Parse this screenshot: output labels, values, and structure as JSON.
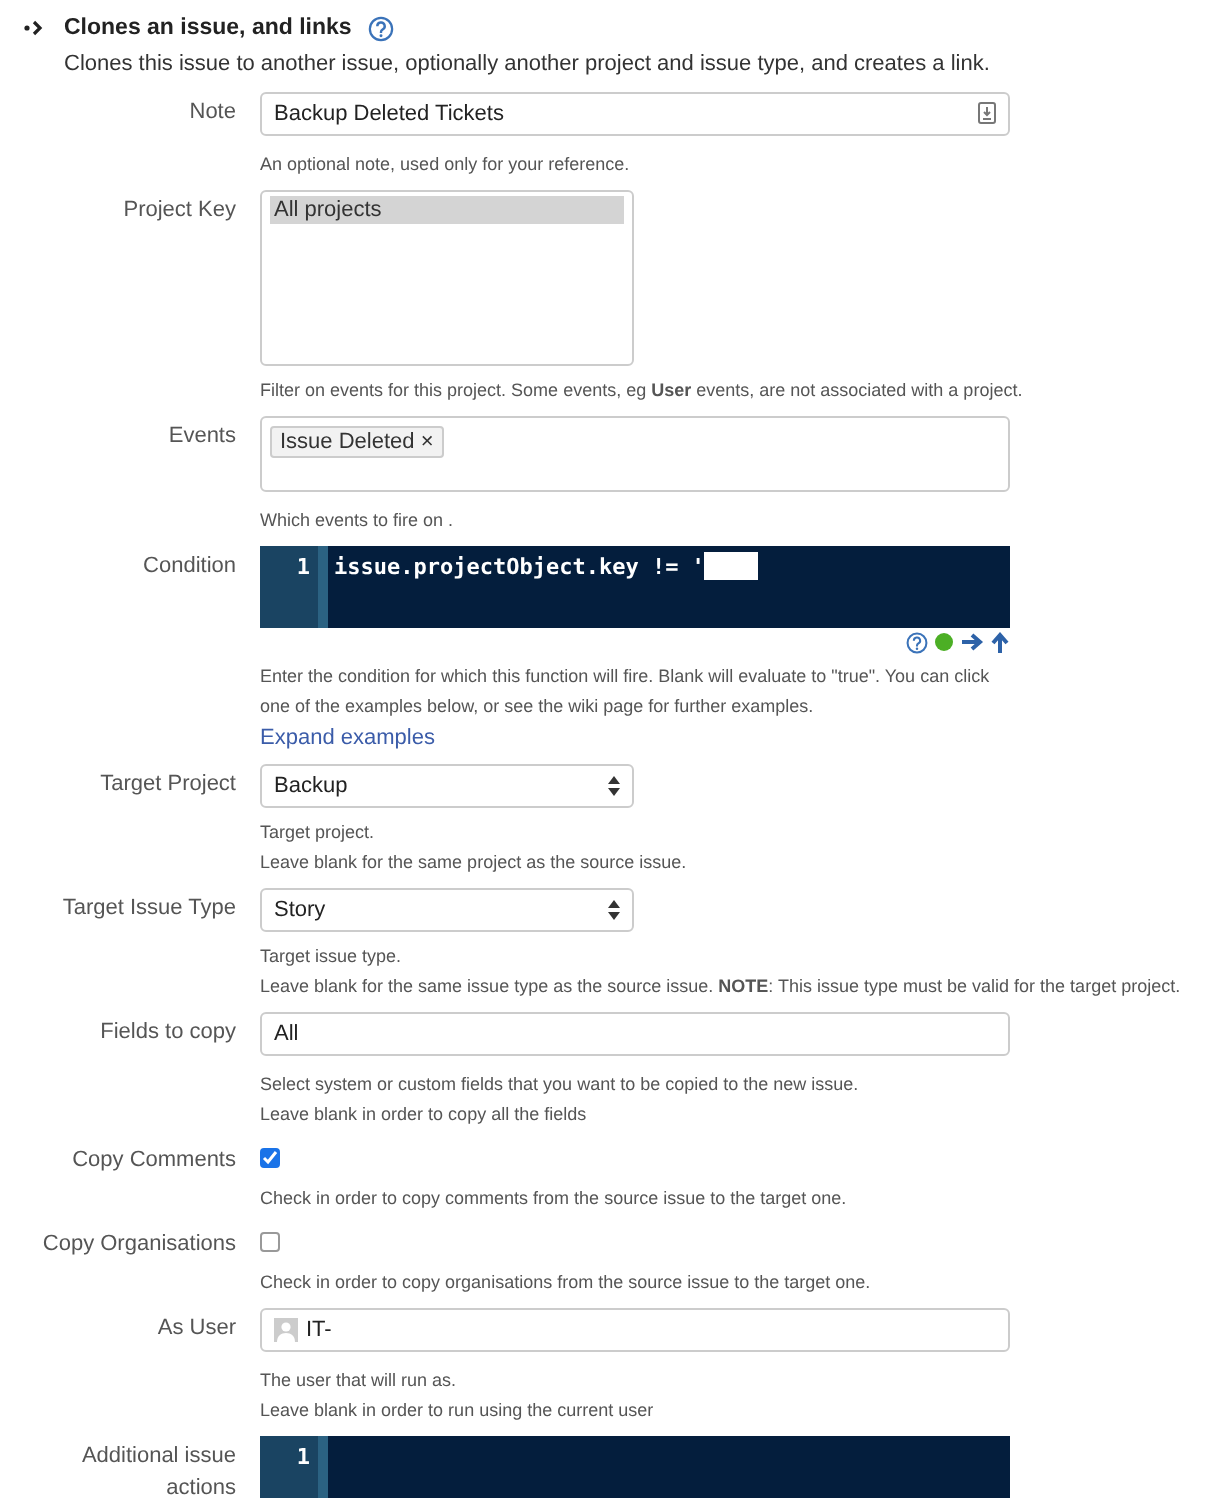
{
  "section": {
    "title": "Clones an issue, and links",
    "description": "Clones this issue to another issue, optionally another project and issue type, and creates a link."
  },
  "fields": [
    {
      "kind": "text",
      "label": "Note",
      "value": "Backup Deleted Tickets",
      "help": [
        "An optional note, used only for your reference."
      ]
    },
    {
      "kind": "listbox",
      "label": "Project Key",
      "options": [
        {
          "text": "All projects",
          "selected": true
        }
      ],
      "help": [
        "Filter on events for this project. Some events, eg **User** events, are not associated with a project."
      ]
    },
    {
      "kind": "tags",
      "label": "Events",
      "tags": [
        "Issue Deleted ×"
      ],
      "help": [
        "Which events to fire on ."
      ]
    },
    {
      "kind": "code",
      "label": "Condition",
      "lines": [
        {
          "number": "1",
          "code": "issue.projectObject.key != '",
          "redacted": true
        }
      ],
      "help": [
        "Enter the condition for which this function will fire. Blank will evaluate to \"true\". You can click",
        "one of the examples below, or see the wiki page for further examples."
      ],
      "link": "Expand examples"
    },
    {
      "kind": "select",
      "label": "Target Project",
      "value": "Backup",
      "help": [
        "Target project.",
        "Leave blank for the same project as the source issue."
      ]
    },
    {
      "kind": "select",
      "label": "Target Issue Type",
      "value": "Story",
      "help": [
        "Target issue type.",
        "Leave blank for the same issue type as the source issue. **NOTE**: This issue type must be valid for the target project."
      ]
    },
    {
      "kind": "text",
      "label": "Fields to copy",
      "value": "All",
      "help": [
        "Select system or custom fields that you want to be copied to the new issue.",
        "Leave blank in order to copy all the fields"
      ]
    },
    {
      "kind": "checkbox",
      "label": "Copy Comments",
      "checked": true,
      "help": [
        "Check in order to copy comments from the source issue to the target one."
      ]
    },
    {
      "kind": "checkbox",
      "label": "Copy Organisations",
      "checked": false,
      "help": [
        "Check in order to copy organisations from the source issue to the target one."
      ]
    },
    {
      "kind": "user",
      "label": "As User",
      "value": "IT-",
      "help": [
        "The user that will run as.",
        "Leave blank in order to run using the current user"
      ]
    },
    {
      "kind": "code",
      "label": "Additional issue actions",
      "lines": [
        {
          "number": "1",
          "redacted": false
        }
      ]
    }
  ]
}
